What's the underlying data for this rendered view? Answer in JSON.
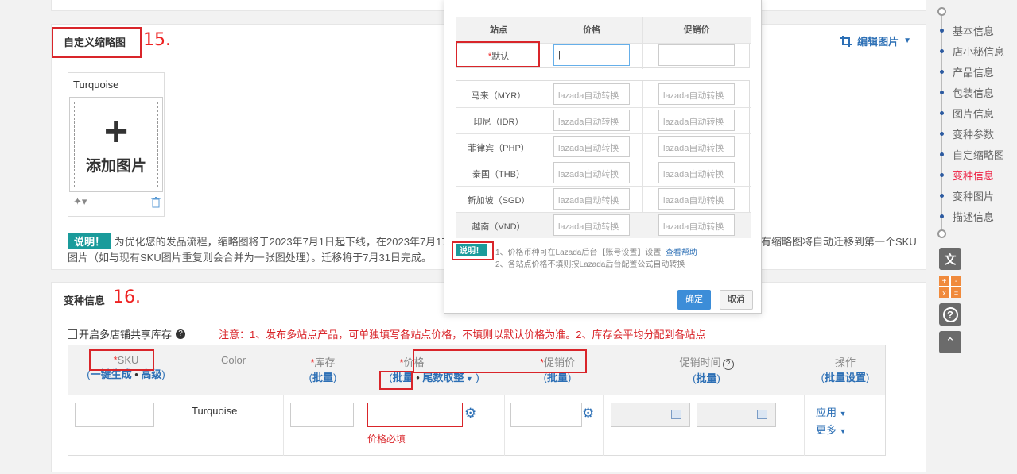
{
  "thumb_section": {
    "title": "自定义缩略图",
    "annotation": "15.",
    "edit_image": "编辑图片",
    "tile_label": "Turquoise",
    "add_image": "添加图片",
    "note_tag": "说明！",
    "note_line1_left": "为优化您的发品流程，缩略图将于2023年7月1日起下线，在2023年7月17",
    "note_line1_right": "有缩略图将自动迁移到第一个SKU",
    "note_line2": "图片（如与现有SKU图片重复则会合并为一张图处理）。迁移将于7月31日完成。"
  },
  "variant_section": {
    "title": "变种信息",
    "annotation": "16.",
    "share_stock": "开启多店铺共享库存",
    "warning": "注意：1、发布多站点产品，可单独填写各站点价格，不填则以默认价格为准。2、库存会平均分配到各站点",
    "headers": {
      "sku": "SKU",
      "sku_gen": "一键生成",
      "sku_adv": "高级",
      "color": "Color",
      "stock": "库存",
      "batch": "批量",
      "price": "价格",
      "tail": "尾数取整",
      "promo": "促销价",
      "promo_time": "促销时间",
      "ops": "操作",
      "batch_set": "批量设置"
    },
    "row": {
      "color": "Turquoise",
      "price_required": "价格必填",
      "apply": "应用",
      "more": "更多"
    }
  },
  "nav": {
    "items": [
      "基本信息",
      "店小秘信息",
      "产品信息",
      "包装信息",
      "图片信息",
      "变种参数",
      "自定缩略图",
      "变种信息",
      "变种图片",
      "描述信息"
    ],
    "active": "变种信息"
  },
  "modal": {
    "col_site": "站点",
    "col_price": "价格",
    "col_promo": "促销价",
    "default_site": "默认",
    "sites": [
      "马来（MYR）",
      "印尼（IDR）",
      "菲律宾（PHP）",
      "泰国（THB）",
      "新加坡（SGD）",
      "越南（VND）"
    ],
    "auto_placeholder": "lazada自动转换",
    "note_tag": "说明！",
    "note1": "1、价格币种可在Lazada后台【账号设置】设置",
    "help": "查看帮助",
    "note2": "2、各站点价格不填则按Lazada后台配置公式自动转换",
    "ok": "确定",
    "cancel": "取消"
  },
  "colors": {
    "accent": "#2c6fb5",
    "annotation_red": "#d9252a",
    "teal": "#1a9b9b"
  }
}
